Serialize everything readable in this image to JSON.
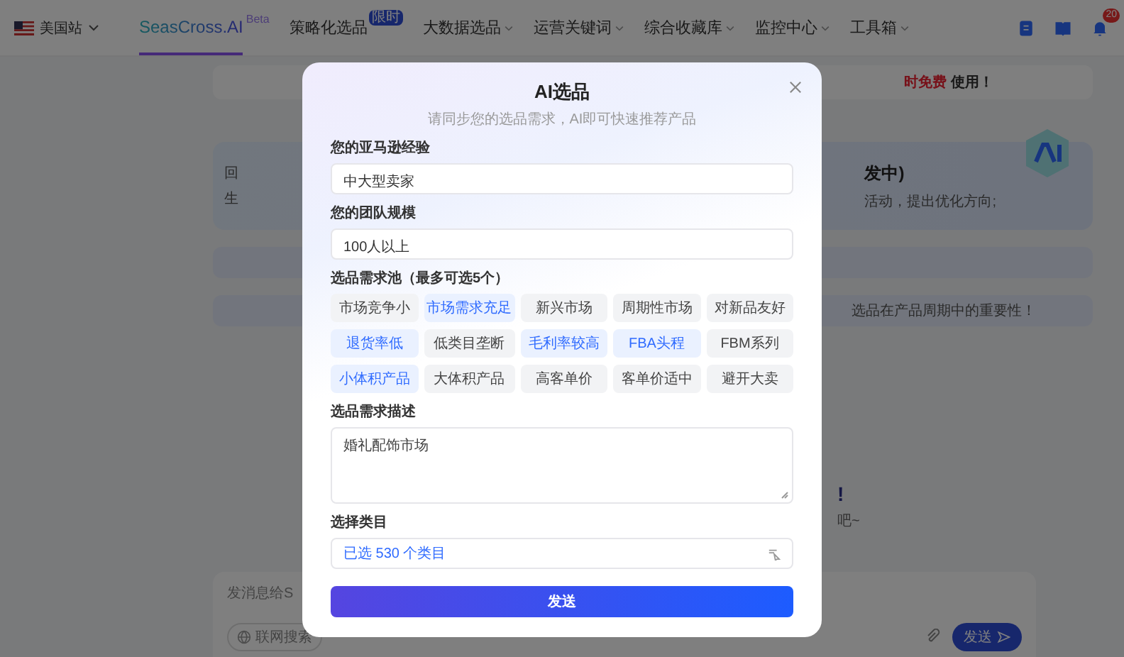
{
  "header": {
    "site": "美国站",
    "nav": [
      {
        "kind": "logo",
        "label": "SeasCross.AI",
        "badge": "Beta",
        "selected": true,
        "dropdown": false
      },
      {
        "kind": "item",
        "label": "策略化选品",
        "badge": "限时",
        "selected": false,
        "dropdown": false
      },
      {
        "kind": "item",
        "label": "大数据选品",
        "selected": false,
        "dropdown": true
      },
      {
        "kind": "item",
        "label": "运营关键词",
        "selected": false,
        "dropdown": true
      },
      {
        "kind": "item",
        "label": "综合收藏库",
        "selected": false,
        "dropdown": true
      },
      {
        "kind": "item",
        "label": "监控中心",
        "selected": false,
        "dropdown": true
      },
      {
        "kind": "item",
        "label": "工具箱",
        "selected": false,
        "dropdown": true
      }
    ],
    "notification_count": "20"
  },
  "background": {
    "banner": {
      "highlight": "时免费",
      "text": "使用！"
    },
    "feature_card": {
      "left_lines": [
        "回",
        "生"
      ],
      "title": "发中)",
      "text": "活动，提出优化方向;"
    },
    "tip_card": {
      "text": "选品在产品周期中的重要性！"
    },
    "headline": "!",
    "subline": "吧~",
    "chat": {
      "placeholder": "发消息给S",
      "web_search": "联网搜索",
      "send": "发送"
    }
  },
  "modal": {
    "title": "AI选品",
    "subtitle": "请同步您的选品需求，AI即可快速推荐产品",
    "fields": [
      {
        "kind": "input",
        "label": "您的亚马逊经验",
        "value": "中大型卖家"
      },
      {
        "kind": "input",
        "label": "您的团队规模",
        "value": "100人以上"
      },
      {
        "kind": "chips",
        "label": "选品需求池（最多可选5个）",
        "options": [
          {
            "label": "市场竞争小",
            "selected": false
          },
          {
            "label": "市场需求充足",
            "selected": true
          },
          {
            "label": "新兴市场",
            "selected": false
          },
          {
            "label": "周期性市场",
            "selected": false
          },
          {
            "label": "对新品友好",
            "selected": false
          },
          {
            "label": "退货率低",
            "selected": true
          },
          {
            "label": "低类目垄断",
            "selected": false
          },
          {
            "label": "毛利率较高",
            "selected": true
          },
          {
            "label": "FBA头程",
            "selected": true
          },
          {
            "label": "FBM系列",
            "selected": false
          },
          {
            "label": "小体积产品",
            "selected": true
          },
          {
            "label": "大体积产品",
            "selected": false
          },
          {
            "label": "高客单价",
            "selected": false
          },
          {
            "label": "客单价适中",
            "selected": false
          },
          {
            "label": "避开大卖",
            "selected": false
          }
        ]
      },
      {
        "kind": "textarea",
        "label": "选品需求描述",
        "value": "婚礼配饰市场"
      },
      {
        "kind": "select",
        "label": "选择类目",
        "value": "已选 530 个类目"
      }
    ],
    "submit": "发送"
  }
}
